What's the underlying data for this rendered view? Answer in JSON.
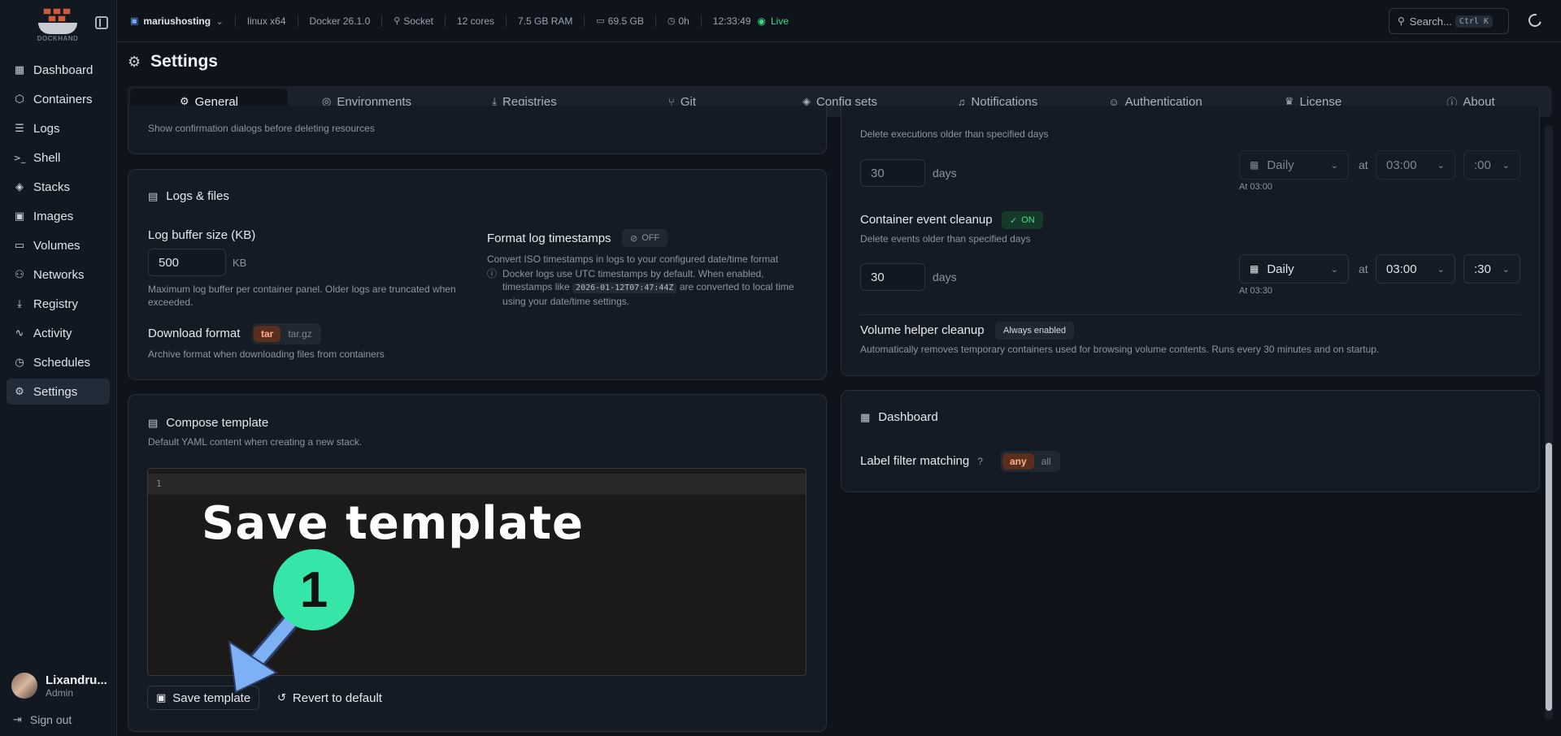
{
  "app": {
    "brand": "DOCKHAND"
  },
  "nav": [
    {
      "label": "Dashboard",
      "icon": "dashboard-icon",
      "glyph": "▦"
    },
    {
      "label": "Containers",
      "icon": "container-icon",
      "glyph": "⬡"
    },
    {
      "label": "Logs",
      "icon": "logs-icon",
      "glyph": "☰"
    },
    {
      "label": "Shell",
      "icon": "terminal-icon",
      "glyph": ">_"
    },
    {
      "label": "Stacks",
      "icon": "layers-icon",
      "glyph": "◈"
    },
    {
      "label": "Images",
      "icon": "image-icon",
      "glyph": "▣"
    },
    {
      "label": "Volumes",
      "icon": "hard-drive-icon",
      "glyph": "▭"
    },
    {
      "label": "Networks",
      "icon": "network-icon",
      "glyph": "⚇"
    },
    {
      "label": "Registry",
      "icon": "download-icon",
      "glyph": "⤓"
    },
    {
      "label": "Activity",
      "icon": "activity-icon",
      "glyph": "∿"
    },
    {
      "label": "Schedules",
      "icon": "timer-icon",
      "glyph": "◷"
    },
    {
      "label": "Settings",
      "icon": "gear-icon",
      "glyph": "⚙"
    }
  ],
  "user": {
    "name": "Lixandru...",
    "role": "Admin",
    "signout": "Sign out"
  },
  "topbar": {
    "env": "mariushosting",
    "os": "linux x64",
    "docker": "Docker 26.1.0",
    "socket": "Socket",
    "cores": "12 cores",
    "ram": "7.5 GB RAM",
    "disk": "69.5 GB",
    "uptime": "0h",
    "time": "12:33:49",
    "live": "Live",
    "search_placeholder": "Search...",
    "search_kbd": "Ctrl K"
  },
  "page": {
    "title": "Settings"
  },
  "tabs": [
    {
      "label": "General",
      "icon": "gear-icon",
      "glyph": "⚙"
    },
    {
      "label": "Environments",
      "icon": "globe-icon",
      "glyph": "◎"
    },
    {
      "label": "Registries",
      "icon": "download-icon",
      "glyph": "⤓"
    },
    {
      "label": "Git",
      "icon": "git-branch-icon",
      "glyph": "⑂"
    },
    {
      "label": "Config sets",
      "icon": "layers-icon",
      "glyph": "◈"
    },
    {
      "label": "Notifications",
      "icon": "bell-icon",
      "glyph": "♫"
    },
    {
      "label": "Authentication",
      "icon": "users-icon",
      "glyph": "☺"
    },
    {
      "label": "License",
      "icon": "crown-icon",
      "glyph": "♛"
    },
    {
      "label": "About",
      "icon": "info-icon",
      "glyph": "ⓘ"
    }
  ],
  "confirm": {
    "desc": "Show confirmation dialogs before deleting resources"
  },
  "logs": {
    "title": "Logs & files",
    "buffer_label": "Log buffer size (KB)",
    "buffer_value": "500",
    "buffer_unit": "KB",
    "buffer_desc": "Maximum log buffer per container panel. Older logs are truncated when exceeded.",
    "format_ts_label": "Format log timestamps",
    "format_ts_state": "OFF",
    "format_ts_desc": "Convert ISO timestamps in logs to your configured date/time format",
    "format_ts_note_a": "Docker logs use UTC timestamps by default. When enabled, timestamps like",
    "format_ts_code": "2026-01-12T07:47:44Z",
    "format_ts_note_b": "are converted to local time using your date/time settings.",
    "download_label": "Download format",
    "download_options": [
      "tar",
      "tar.gz"
    ],
    "download_desc": "Archive format when downloading files from containers"
  },
  "compose": {
    "title": "Compose template",
    "desc": "Default YAML content when creating a new stack.",
    "line_no": "1",
    "save": "Save template",
    "revert": "Revert to default"
  },
  "cleanup": {
    "exec_desc": "Delete executions older than specified days",
    "exec_days": "30",
    "days_unit": "days",
    "exec_freq": "Daily",
    "at": "at",
    "exec_time": "03:00",
    "exec_min": ":00",
    "exec_at": "At 03:00",
    "event_label": "Container event cleanup",
    "event_state": "ON",
    "event_desc": "Delete events older than specified days",
    "event_days": "30",
    "event_freq": "Daily",
    "event_time": "03:00",
    "event_min": ":30",
    "event_at": "At 03:30",
    "volume_label": "Volume helper cleanup",
    "volume_badge": "Always enabled",
    "volume_desc": "Automatically removes temporary containers used for browsing volume contents. Runs every 30 minutes and on startup."
  },
  "dashboard": {
    "title": "Dashboard",
    "filter_label": "Label filter matching",
    "filter_options": [
      "any",
      "all"
    ]
  },
  "overlay": {
    "text": "Save template",
    "step": "1"
  },
  "colors": {
    "accent_live": "#3ddc84",
    "step": "#35e6a8",
    "arrow": "#7eb0f5",
    "seg_on": "#5a2e1c"
  }
}
